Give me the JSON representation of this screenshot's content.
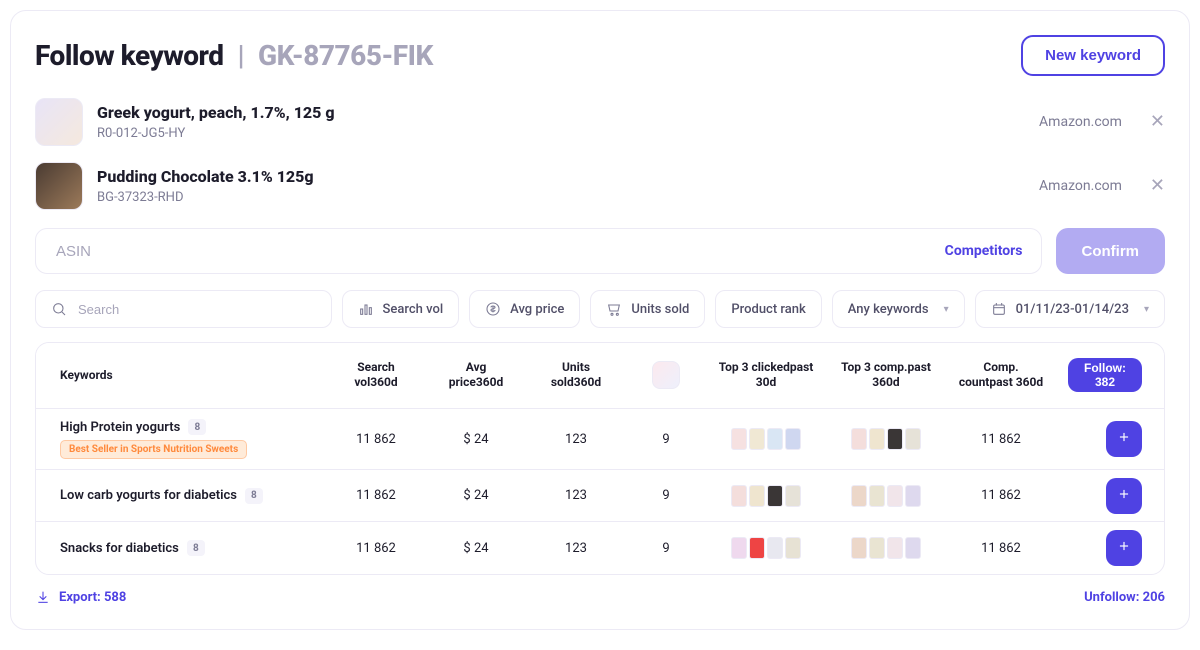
{
  "header": {
    "title": "Follow keyword",
    "separator": "|",
    "code": "GK-87765-FIK",
    "new_keyword": "New keyword"
  },
  "products": [
    {
      "name": "Greek yogurt, peach, 1.7%, 125 g",
      "sku": "R0-012-JG5-HY",
      "source": "Amazon.com"
    },
    {
      "name": "Pudding Chocolate 3.1% 125g",
      "sku": "BG-37323-RHD",
      "source": "Amazon.com"
    }
  ],
  "asin": {
    "placeholder": "ASIN",
    "competitors": "Competitors",
    "confirm": "Confirm"
  },
  "filters": {
    "search_placeholder": "Search",
    "search_vol": "Search vol",
    "avg_price": "Avg price",
    "units_sold": "Units sold",
    "product_rank": "Product rank",
    "any_keywords": "Any keywords",
    "date_range": "01/11/23-01/14/23"
  },
  "table": {
    "head": {
      "keywords": "Keywords",
      "search_vol": "Search vol",
      "search_vol_sub": "360d",
      "avg_price": "Avg price",
      "avg_price_sub": "360d",
      "units_sold": "Units sold",
      "units_sold_sub": "360d",
      "top3_clicked": "Top 3 clicked",
      "top3_clicked_sub": "past 30d",
      "top3_comp": "Top 3 comp.",
      "top3_comp_sub": "past 360d",
      "comp_count": "Comp. count",
      "comp_count_sub": "past 360d",
      "follow": "Follow: 382"
    },
    "rows": [
      {
        "keyword": "High Protein yogurts",
        "count": "8",
        "tag": "Best Seller in Sports Nutrition Sweets",
        "search_vol": "11 862",
        "avg_price": "$ 24",
        "units_sold": "123",
        "rank": "9",
        "comp_count": "11 862"
      },
      {
        "keyword": "Low carb yogurts for diabetics",
        "count": "8",
        "tag": null,
        "search_vol": "11 862",
        "avg_price": "$ 24",
        "units_sold": "123",
        "rank": "9",
        "comp_count": "11 862"
      },
      {
        "keyword": "Snacks for diabetics",
        "count": "8",
        "tag": null,
        "search_vol": "11 862",
        "avg_price": "$ 24",
        "units_sold": "123",
        "rank": "9",
        "comp_count": "11 862"
      }
    ]
  },
  "footer": {
    "export": "Export: 588",
    "unfollow": "Unfollow: 206"
  },
  "thumb_colors": {
    "a": [
      "#f6e1e1",
      "#f0e8d4",
      "#d9e6f4",
      "#cfd7f0"
    ],
    "b": [
      "#f4dedc",
      "#efe5cf",
      "#3a3636",
      "#e6e2d8"
    ],
    "c": [
      "#efd9ee",
      "#e44",
      "#e8e8f0",
      "#e7e2d4"
    ],
    "d": [
      "#ecd7c9",
      "#e9e4d2",
      "#f1e5ea",
      "#ded9ee"
    ]
  }
}
